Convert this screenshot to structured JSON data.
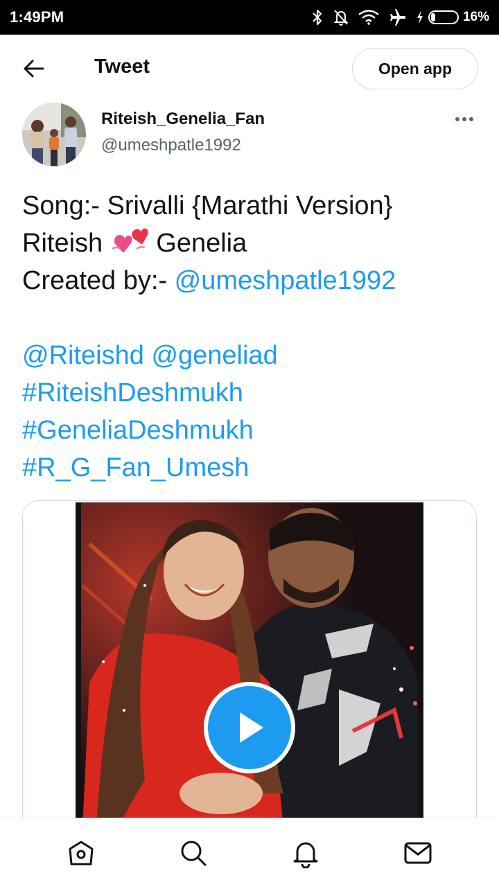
{
  "status_bar": {
    "time": "1:49PM",
    "battery_percent": "16%",
    "battery_level": 0.16,
    "icons": [
      "bluetooth-icon",
      "notifications-off-icon",
      "wifi-icon",
      "airplane-icon",
      "charging-icon",
      "battery-icon"
    ]
  },
  "header": {
    "title": "Tweet",
    "open_app_label": "Open app"
  },
  "author": {
    "name": "Riteish_Genelia_Fan",
    "handle": "@umeshpatle1992"
  },
  "tweet": {
    "line1": "Song:- Srivalli {Marathi Version}",
    "line2_a": "Riteish ",
    "line2_b": " Genelia",
    "line3_prefix": "Created by:- ",
    "line3_link": "@umeshpatle1992",
    "mention1": "@Riteishd",
    "mention2": "@geneliad",
    "hashtag1": "#RiteishDeshmukh",
    "hashtag2": "#GeneliaDeshmukh",
    "hashtag3": "#R_G_Fan_Umesh",
    "emoji": "two-hearts-icon"
  },
  "colors": {
    "link": "#1d9bf0",
    "play_button": "#1d9bf0",
    "secondary_text": "#536471"
  },
  "bottom_nav": [
    "home-icon",
    "search-icon",
    "notifications-icon",
    "messages-icon"
  ]
}
